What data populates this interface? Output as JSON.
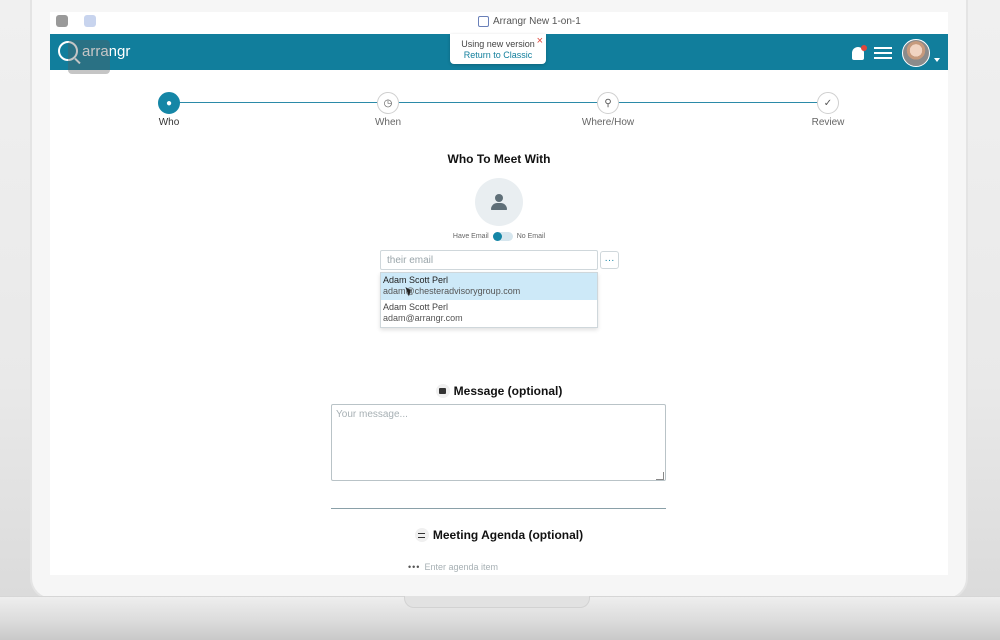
{
  "browser": {
    "tab_title": "Arrangr New 1-on-1"
  },
  "header": {
    "brand": "arrangr",
    "version_notice": {
      "line1": "Using new version",
      "line2": "Return to Classic",
      "close": "×"
    }
  },
  "stepper": {
    "steps": [
      {
        "label": "Who",
        "icon": "person-icon",
        "active": true
      },
      {
        "label": "When",
        "icon": "clock-icon",
        "active": false
      },
      {
        "label": "Where/How",
        "icon": "map-pin-icon",
        "active": false
      },
      {
        "label": "Review",
        "icon": "review-icon",
        "active": false
      }
    ]
  },
  "who": {
    "title": "Who To Meet With",
    "toggle_left": "Have Email",
    "toggle_right": "No Email",
    "email_placeholder": "their email",
    "more_button": "···",
    "suggestions": [
      {
        "name": "Adam Scott Perl",
        "email": "adam@chesteradvisorygroup.com"
      },
      {
        "name": "Adam Scott Perl",
        "email": "adam@arrangr.com"
      }
    ]
  },
  "message": {
    "label": "Message (optional)",
    "placeholder": "Your message..."
  },
  "agenda": {
    "label": "Meeting Agenda (optional)",
    "placeholder": "Enter agenda item"
  },
  "colors": {
    "brand": "#117e9c",
    "accent": "#1586a6",
    "highlight": "#cde9f8",
    "close": "#e0463a"
  }
}
